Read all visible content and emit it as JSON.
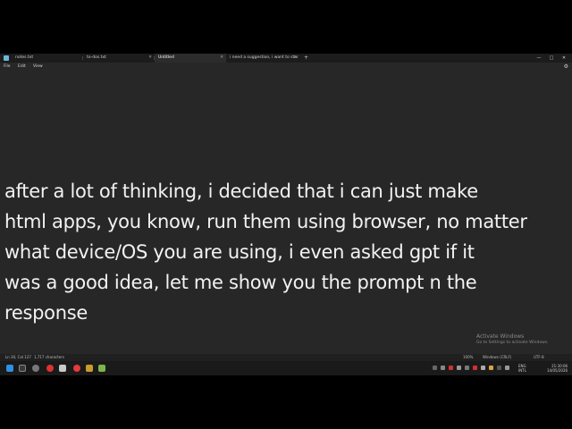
{
  "window": {
    "tabs": [
      {
        "label": "notes.txt",
        "active": false
      },
      {
        "label": "to-dos.txt",
        "active": false
      },
      {
        "label": "Untitled",
        "active": true
      },
      {
        "label": "i need a suggestion, i want to star",
        "active": false
      }
    ],
    "new_tab_label": "+",
    "controls": {
      "minimize": "—",
      "maximize": "□",
      "close": "✕"
    }
  },
  "menu": {
    "items": [
      "File",
      "Edit",
      "View"
    ],
    "settings_icon": "gear-icon"
  },
  "editor": {
    "text": "after a lot of thinking, i decided that i can just make\nhtml apps, you know, run them using browser, no matter\nwhat device/OS you are using, i even asked gpt if it\nwas a good idea, let me show you the prompt n the\nresponse"
  },
  "watermark": {
    "title": "Activate Windows",
    "subtitle": "Go to Settings to activate Windows."
  },
  "status": {
    "position": "Ln 30, Col 127",
    "characters": "1,717 characters",
    "zoom": "100%",
    "line_ending": "Windows (CRLF)",
    "encoding": "UTF-8"
  },
  "taskbar": {
    "icons": [
      "windows-start-icon",
      "search-icon",
      "settings-icon",
      "chrome-icon",
      "file-explorer-icon",
      "recorder-icon",
      "media-icon",
      "folder-icon",
      "drive-icon"
    ],
    "language_top": "ENG",
    "language_bottom": "INTL",
    "time": "21:30:06",
    "date": "14/05/2026"
  },
  "colors": {
    "editor_bg": "#272727",
    "text": "#f2f2f2",
    "accent": "#6cb6d9"
  }
}
